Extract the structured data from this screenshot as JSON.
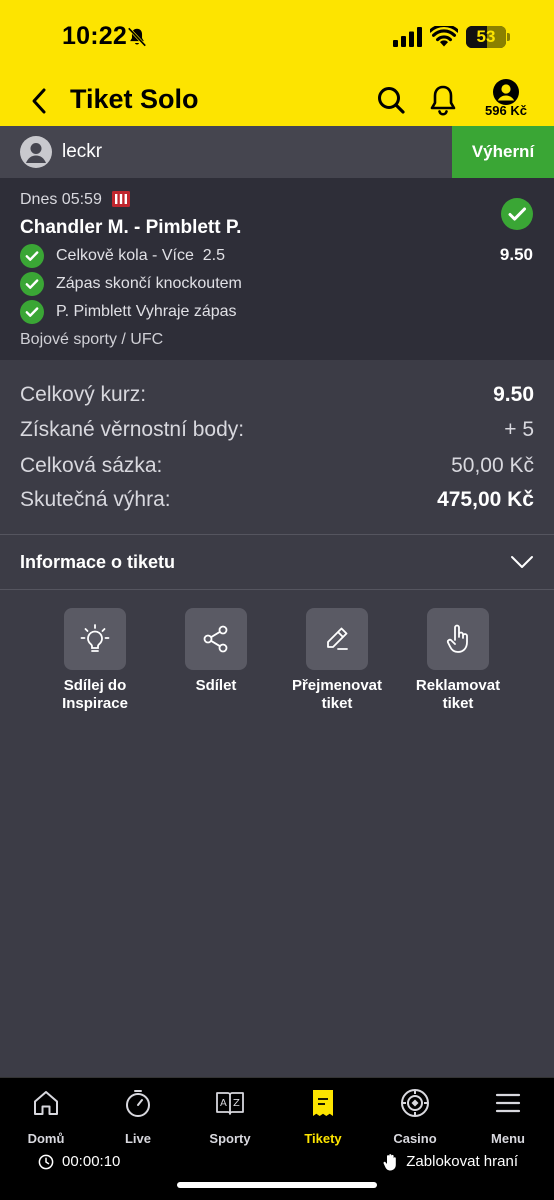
{
  "status_bar": {
    "time": "10:22",
    "battery": "53",
    "battery_fraction": 0.53
  },
  "header": {
    "title": "Tiket Solo",
    "balance": "596 Kč"
  },
  "user": {
    "name": "leckr",
    "badge": "Výherní"
  },
  "bet": {
    "date": "Dnes 05:59",
    "match": "Chandler M. - Pimblett P.",
    "odds": "9.50",
    "selections": [
      {
        "label": "Celkově kola - Více  2.5"
      },
      {
        "label": "Zápas skončí knockoutem"
      },
      {
        "label": "P. Pimblett Vyhraje zápas"
      }
    ],
    "category": "Bojové sporty / UFC"
  },
  "summary": {
    "total_odds_label": "Celkový kurz:",
    "total_odds": "9.50",
    "points_label": "Získané věrnostní body:",
    "points": "+ 5",
    "stake_label": "Celková sázka:",
    "stake": "50,00 Kč",
    "win_label": "Skutečná výhra:",
    "win": "475,00 Kč"
  },
  "info": {
    "label": "Informace o tiketu"
  },
  "actions": [
    {
      "label": "Sdílej do\nInspirace",
      "line1": "Sdílej do",
      "line2": "Inspirace",
      "icon": "lightbulb-icon"
    },
    {
      "label": "Sdílet",
      "line1": "Sdílet",
      "line2": "",
      "icon": "share-icon"
    },
    {
      "label": "Přejmenovat tiket",
      "line1": "Přejmenovat",
      "line2": "tiket",
      "icon": "pencil-icon"
    },
    {
      "label": "Reklamovat tiket",
      "line1": "Reklamovat",
      "line2": "tiket",
      "icon": "hand-icon"
    }
  ],
  "nav": {
    "items": [
      {
        "label": "Domů",
        "icon": "home-icon"
      },
      {
        "label": "Live",
        "icon": "stopwatch-icon"
      },
      {
        "label": "Sporty",
        "icon": "az-book-icon"
      },
      {
        "label": "Tikety",
        "icon": "ticket-icon",
        "active": true
      },
      {
        "label": "Casino",
        "icon": "casino-chip-icon"
      },
      {
        "label": "Menu",
        "icon": "menu-icon"
      }
    ],
    "timer": "00:00:10",
    "block": "Zablokovat hraní"
  },
  "colors": {
    "brand_yellow": "#fde400",
    "win_green": "#3aa635",
    "background": "#3c3c46"
  }
}
